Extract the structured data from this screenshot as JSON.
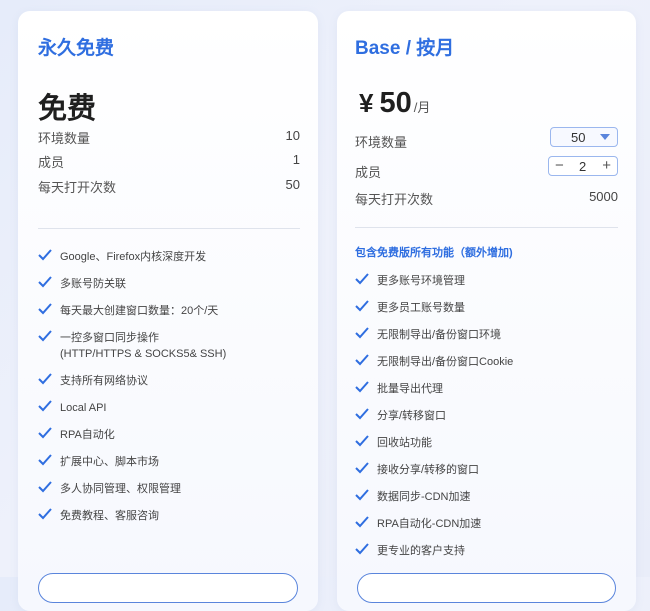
{
  "colors": {
    "accent": "#2f6ee0",
    "check": "#2f6ee0",
    "page_bg": "#e9edf9"
  },
  "free_plan": {
    "title": "永久免费",
    "price_text": "免费",
    "stats": [
      {
        "label": "环境数量",
        "value": "10"
      },
      {
        "label": "成员",
        "value": "1"
      },
      {
        "label": "每天打开次数",
        "value": "50"
      }
    ],
    "features": [
      {
        "line1": "Google、Firefox内核深度开发"
      },
      {
        "line1": "多账号防关联"
      },
      {
        "line1": "每天最大创建窗口数量：20个/天"
      },
      {
        "line1": "一控多窗口同步操作",
        "line2": "(HTTP/HTTPS & SOCKS5& SSH)"
      },
      {
        "line1": "支持所有网络协议"
      },
      {
        "line1": "Local API"
      },
      {
        "line1": "RPA自动化"
      },
      {
        "line1": "扩展中心、脚本市场"
      },
      {
        "line1": "多人协同管理、权限管理"
      },
      {
        "line1": "免费教程、客服咨询"
      }
    ]
  },
  "base_plan": {
    "title": "Base / 按月",
    "currency": "¥",
    "price": "50",
    "unit": "/月",
    "env_label": "环境数量",
    "env_selected": "50",
    "members_label": "成员",
    "members_value": "2",
    "stepper_minus": "−",
    "stepper_plus": "+",
    "opens_label": "每天打开次数",
    "opens_value": "5000",
    "section_title": "包含免费版所有功能（额外增加)",
    "features": [
      "更多账号环境管理",
      "更多员工账号数量",
      "无限制导出/备份窗口环境",
      "无限制导出/备份窗口Cookie",
      "批量导出代理",
      "分享/转移窗口",
      "回收站功能",
      "接收分享/转移的窗口",
      "数据同步-CDN加速",
      "RPA自动化-CDN加速",
      "更专业的客户支持"
    ]
  }
}
